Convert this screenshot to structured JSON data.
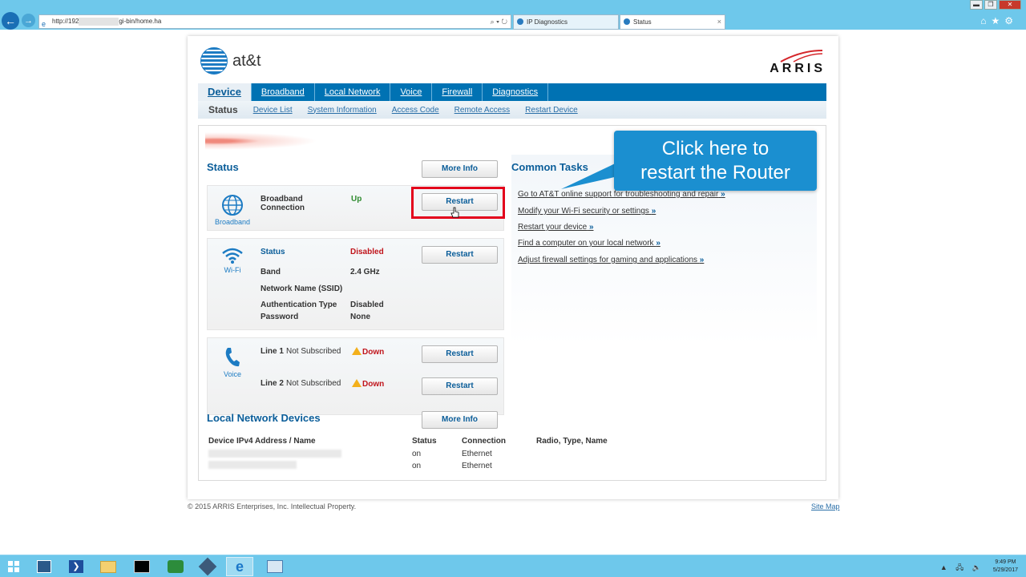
{
  "browser": {
    "address_prefix": "http://192",
    "address_suffix": "gi-bin/home.ha",
    "address_tools": "⌕ ▾ ↻",
    "tabs": [
      {
        "title": "IP Diagnostics"
      },
      {
        "title": "Status"
      }
    ],
    "tab_close": "×",
    "window_controls": {
      "minimize": "▬",
      "restore": "❐",
      "close": "✕"
    },
    "command_icons": "⌂★⚙"
  },
  "header": {
    "att_logo_text": "at&t",
    "arris_logo_text": "ARRIS"
  },
  "main_nav": [
    {
      "label": "Device",
      "active": true
    },
    {
      "label": "Broadband"
    },
    {
      "label": "Local Network"
    },
    {
      "label": "Voice"
    },
    {
      "label": "Firewall"
    },
    {
      "label": "Diagnostics"
    }
  ],
  "sub_nav": [
    {
      "label": "Status",
      "active": true
    },
    {
      "label": "Device List"
    },
    {
      "label": "System Information"
    },
    {
      "label": "Access Code"
    },
    {
      "label": "Remote Access"
    },
    {
      "label": "Restart Device"
    }
  ],
  "status": {
    "title": "Status",
    "more_info_label": "More Info",
    "broadband": {
      "icon_label": "Broadband",
      "name_line1": "Broadband",
      "name_line2": "Connection",
      "value": "Up",
      "restart_label": "Restart"
    },
    "wifi": {
      "icon_label": "Wi-Fi",
      "status_label": "Status",
      "status_value": "Disabled",
      "band_label": "Band",
      "band_value": "2.4 GHz",
      "ssid_label": "Network Name (SSID)",
      "auth_label": "Authentication Type",
      "auth_value": "Disabled",
      "password_label": "Password",
      "password_value": "None",
      "restart_label": "Restart"
    },
    "voice": {
      "icon_label": "Voice",
      "line1_label": "Line 1",
      "line1_sub": "Not Subscribed",
      "line1_value": "Down",
      "line2_label": "Line 2",
      "line2_sub": "Not Subscribed",
      "line2_value": "Down",
      "restart_label": "Restart"
    }
  },
  "common_tasks": {
    "title": "Common Tasks",
    "items": [
      "Go to AT&T online support for troubleshooting and repair",
      "Modify your Wi-Fi security or settings",
      "Restart your device",
      "Find a computer on your local network",
      "Adjust firewall settings for gaming and applications"
    ],
    "chevron": "»"
  },
  "callout": {
    "line1": "Click here to",
    "line2": "restart the Router"
  },
  "local_network": {
    "title": "Local Network Devices",
    "more_info_label": "More Info",
    "columns": [
      "Device IPv4 Address / Name",
      "Status",
      "Connection",
      "Radio, Type, Name"
    ],
    "rows": [
      {
        "status": "on",
        "connection": "Ethernet"
      },
      {
        "status": "on",
        "connection": "Ethernet"
      }
    ]
  },
  "footer": {
    "copyright": "© 2015 ARRIS Enterprises, Inc. Intellectual Property.",
    "site_map": "Site Map"
  },
  "taskbar": {
    "clock_time": "9:49 PM",
    "clock_date": "5/29/2017",
    "tray": "▲ 🖧 🔈"
  },
  "colors": {
    "att_blue": "#0072b3",
    "link_blue": "#0a5d99",
    "status_green": "#2f8b2f",
    "status_red": "#c0141b",
    "highlight_red": "#e3001b",
    "callout_blue": "#1b8fd0",
    "chrome_blue": "#6ec8eb"
  }
}
